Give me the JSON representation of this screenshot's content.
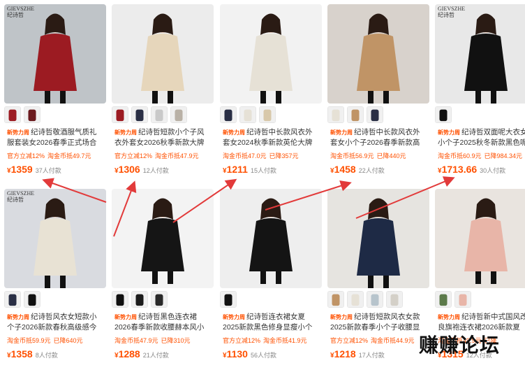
{
  "products": [
    {
      "title": "纪诗哲敬酒服气质礼服套装女2026春季正式场合红色西服",
      "tag": "新势力周",
      "promos": [
        "官方立减12%",
        "淘金币抵49.7元"
      ],
      "price": "1359",
      "sold": "37人付款",
      "coat": "#9c1b22",
      "bg": "#bfc4c8",
      "thumbs": [
        "#9c1b22",
        "#6b1a1e"
      ],
      "brand": "GIEVSZHE\n纪诗哲"
    },
    {
      "title": "纪诗哲短款小个子风衣外套女2026秋季新款大牌高端英伦风",
      "tag": "新势力周",
      "promos": [
        "官方立减12%",
        "淘金币抵47.9元"
      ],
      "price": "1306",
      "sold": "12人付款",
      "coat": "#e6d6bb",
      "bg": "#ececec",
      "thumbs": [
        "#9c1b22",
        "#2a2f45",
        "#c9c9c9",
        "#b9b1a6"
      ],
      "brand": ""
    },
    {
      "title": "纪诗哲中长款风衣外套女2024秋季新款英伦大牌高端",
      "tag": "新势力周",
      "promos": [
        "淘金币抵47.0元",
        "已降357元"
      ],
      "price": "1211",
      "sold": "15人付款",
      "coat": "#e6e1d6",
      "bg": "#f2f2f2",
      "thumbs": [
        "#2a2f45",
        "#e6e1d6",
        "#d8c8aa"
      ],
      "brand": ""
    },
    {
      "title": "纪诗哲中长款风衣外套女小个子2026春季新款高级感英",
      "tag": "新势力周",
      "promos": [
        "淘金币抵56.9元",
        "已降440元"
      ],
      "price": "1458",
      "sold": "22人付款",
      "coat": "#c09466",
      "bg": "#d8d2cc",
      "thumbs": [
        "#e6e1d6",
        "#c09466",
        "#2a2f45"
      ],
      "brand": ""
    },
    {
      "title": "纪诗哲双面呢大衣女小个子2025秋冬新款黑色呢子",
      "tag": "新势力周",
      "promos": [
        "淘金币抵60.9元",
        "已降984.34元"
      ],
      "price": "1713.66",
      "sold": "30人付款",
      "coat": "#111111",
      "bg": "#e8e8e8",
      "thumbs": [
        "#111111"
      ],
      "brand": "GIEVSZHE\n纪诗哲"
    },
    {
      "title": "纪诗哲风衣女短款小个子2026新款春秋高级感今年流行",
      "tag": "新势力周",
      "promos": [
        "淘金币抵59.9元",
        "已降640元"
      ],
      "price": "1358",
      "sold": "8人付款",
      "coat": "#e8e2d4",
      "bg": "#d9dbe0",
      "thumbs": [
        "#2a2f45",
        "#111111"
      ],
      "brand": "GIEVSZHE\n纪诗哲"
    },
    {
      "title": "纪诗哲黑色连衣裙2026春季新款收腰赫本风小个子气",
      "tag": "新势力周",
      "promos": [
        "淘金币抵47.9元",
        "已降310元"
      ],
      "price": "1288",
      "sold": "21人付款",
      "coat": "#151515",
      "bg": "#f3f3f3",
      "thumbs": [
        "#111111",
        "#1c1c1c",
        "#2a2a2a"
      ],
      "brand": ""
    },
    {
      "title": "纪诗哲连衣裙女夏2025新款黑色修身显瘦小个子法式气",
      "tag": "新势力周",
      "promos": [
        "官方立减12%",
        "淘金币抵41.9元"
      ],
      "price": "1130",
      "sold": "56人付款",
      "coat": "#141414",
      "bg": "#eeeeee",
      "thumbs": [
        "#111111"
      ],
      "brand": ""
    },
    {
      "title": "纪诗哲短款风衣女款2025新款春季小个子收腰显瘦",
      "tag": "新势力周",
      "promos": [
        "官方立减12%",
        "淘金币抵44.9元"
      ],
      "price": "1218",
      "sold": "17人付款",
      "coat": "#1e2a45",
      "bg": "#e6e4e0",
      "thumbs": [
        "#c09466",
        "#e6e1d6",
        "#b7c4cc",
        "#d4d0c8"
      ],
      "brand": ""
    },
    {
      "title": "纪诗哲新中式国风改良旗袍连衣裙2026新款夏",
      "tag": "新势力周",
      "promos": [
        "淘金币抵49.9元",
        "已降"
      ],
      "price": "1315",
      "sold": "12人付款",
      "coat": "#e8b5a8",
      "bg": "#e9e4df",
      "thumbs": [
        "#5c7a4a",
        "#e8b5a8"
      ],
      "brand": ""
    }
  ],
  "watermark": "赚赚论坛",
  "currency": "¥"
}
